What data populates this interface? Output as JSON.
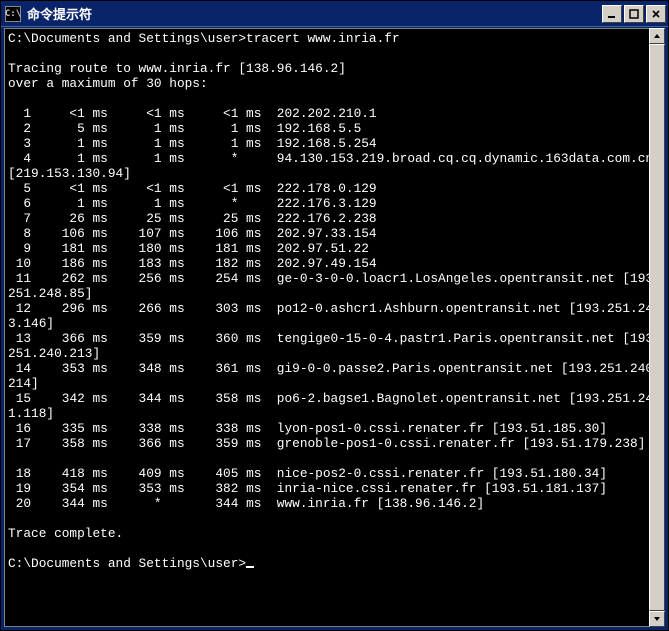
{
  "titlebar": {
    "icon_text": "C:\\",
    "title": "命令提示符"
  },
  "prompt_path": "C:\\Documents and Settings\\user>",
  "command": "tracert www.inria.fr",
  "header_line1": "Tracing route to www.inria.fr [138.96.146.2]",
  "header_line2": "over a maximum of 30 hops:",
  "hops": [
    {
      "n": 1,
      "t1": "<1 ms",
      "t2": "<1 ms",
      "t3": "<1 ms",
      "host": "202.202.210.1"
    },
    {
      "n": 2,
      "t1": "5 ms",
      "t2": "1 ms",
      "t3": "1 ms",
      "host": "192.168.5.5"
    },
    {
      "n": 3,
      "t1": "1 ms",
      "t2": "1 ms",
      "t3": "1 ms",
      "host": "192.168.5.254"
    },
    {
      "n": 4,
      "t1": "1 ms",
      "t2": "1 ms",
      "t3": "*",
      "host": "94.130.153.219.broad.cq.cq.dynamic.163data.com.cn [219.153.130.94]"
    },
    {
      "n": 5,
      "t1": "<1 ms",
      "t2": "<1 ms",
      "t3": "<1 ms",
      "host": "222.178.0.129"
    },
    {
      "n": 6,
      "t1": "1 ms",
      "t2": "1 ms",
      "t3": "*",
      "host": "222.176.3.129"
    },
    {
      "n": 7,
      "t1": "26 ms",
      "t2": "25 ms",
      "t3": "25 ms",
      "host": "222.176.2.238"
    },
    {
      "n": 8,
      "t1": "106 ms",
      "t2": "107 ms",
      "t3": "106 ms",
      "host": "202.97.33.154"
    },
    {
      "n": 9,
      "t1": "181 ms",
      "t2": "180 ms",
      "t3": "181 ms",
      "host": "202.97.51.22"
    },
    {
      "n": 10,
      "t1": "186 ms",
      "t2": "183 ms",
      "t3": "182 ms",
      "host": "202.97.49.154"
    },
    {
      "n": 11,
      "t1": "262 ms",
      "t2": "256 ms",
      "t3": "254 ms",
      "host": "ge-0-3-0-0.loacr1.LosAngeles.opentransit.net [193.251.248.85]"
    },
    {
      "n": 12,
      "t1": "296 ms",
      "t2": "266 ms",
      "t3": "303 ms",
      "host": "po12-0.ashcr1.Ashburn.opentransit.net [193.251.243.146]"
    },
    {
      "n": 13,
      "t1": "366 ms",
      "t2": "359 ms",
      "t3": "360 ms",
      "host": "tengige0-15-0-4.pastr1.Paris.opentransit.net [193.251.240.213]"
    },
    {
      "n": 14,
      "t1": "353 ms",
      "t2": "348 ms",
      "t3": "361 ms",
      "host": "gi9-0-0.passe2.Paris.opentransit.net [193.251.240.214]"
    },
    {
      "n": 15,
      "t1": "342 ms",
      "t2": "344 ms",
      "t3": "358 ms",
      "host": "po6-2.bagse1.Bagnolet.opentransit.net [193.251.241.118]"
    },
    {
      "n": 16,
      "t1": "335 ms",
      "t2": "338 ms",
      "t3": "338 ms",
      "host": "lyon-pos1-0.cssi.renater.fr [193.51.185.30]"
    },
    {
      "n": 17,
      "t1": "358 ms",
      "t2": "366 ms",
      "t3": "359 ms",
      "host": "grenoble-pos1-0.cssi.renater.fr [193.51.179.238]"
    },
    {
      "n": 18,
      "t1": "418 ms",
      "t2": "409 ms",
      "t3": "405 ms",
      "host": "nice-pos2-0.cssi.renater.fr [193.51.180.34]",
      "blank_before": true
    },
    {
      "n": 19,
      "t1": "354 ms",
      "t2": "353 ms",
      "t3": "382 ms",
      "host": "inria-nice.cssi.renater.fr [193.51.181.137]"
    },
    {
      "n": 20,
      "t1": "344 ms",
      "t2": "*",
      "t3": "344 ms",
      "host": "www.inria.fr [138.96.146.2]"
    }
  ],
  "trace_complete": "Trace complete.",
  "end_prompt": "C:\\Documents and Settings\\user>"
}
